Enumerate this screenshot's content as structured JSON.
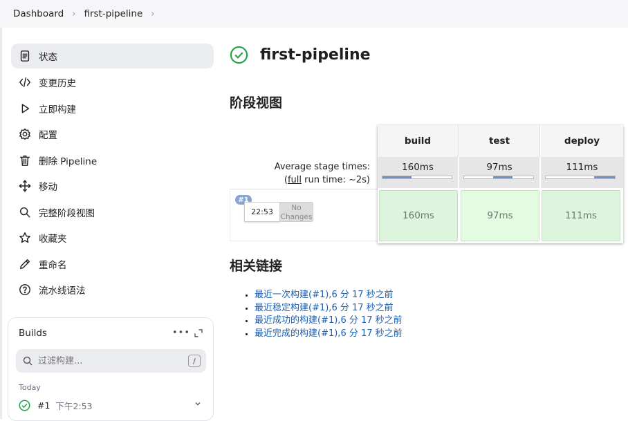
{
  "breadcrumb": {
    "items": [
      "Dashboard",
      "first-pipeline"
    ]
  },
  "sidebar": {
    "items": [
      {
        "label": "状态",
        "icon": "document-icon",
        "active": true
      },
      {
        "label": "变更历史",
        "icon": "code-icon"
      },
      {
        "label": "立即构建",
        "icon": "play-icon"
      },
      {
        "label": "配置",
        "icon": "gear-icon"
      },
      {
        "label": "删除 Pipeline",
        "icon": "trash-icon"
      },
      {
        "label": "移动",
        "icon": "move-icon"
      },
      {
        "label": "完整阶段视图",
        "icon": "search-icon"
      },
      {
        "label": "收藏夹",
        "icon": "star-icon"
      },
      {
        "label": "重命名",
        "icon": "pencil-icon"
      },
      {
        "label": "流水线语法",
        "icon": "help-icon"
      }
    ]
  },
  "builds_panel": {
    "title": "Builds",
    "filter_placeholder": "过滤构建...",
    "shortcut": "/",
    "group": "Today",
    "build": {
      "number": "#1",
      "time": "下午2:53",
      "status": "success"
    }
  },
  "page": {
    "title": "first-pipeline",
    "status_color": "#1ea446"
  },
  "stage_view": {
    "heading": "阶段视图",
    "avg_label": "Average stage times:",
    "full_run_prefix": "(",
    "full_run_link": "full",
    "full_run_suffix": " run time: ~2s)",
    "stages": [
      {
        "name": "build",
        "avg": "160ms",
        "progress_start": 0.0,
        "progress_end": 0.42
      },
      {
        "name": "test",
        "avg": "97ms",
        "progress_start": 0.42,
        "progress_end": 0.7
      },
      {
        "name": "deploy",
        "avg": "111ms",
        "progress_start": 0.7,
        "progress_end": 1.0
      }
    ],
    "run": {
      "badge": "#1",
      "time": "22:53",
      "changes_line1": "No",
      "changes_line2": "Changes",
      "cells": [
        "160ms",
        "97ms",
        "111ms"
      ]
    }
  },
  "related_links": {
    "heading": "相关链接",
    "items": [
      "最近一次构建(#1),6 分 17 秒之前",
      "最近稳定构建(#1),6 分 17 秒之前",
      "最近成功的构建(#1),6 分 17 秒之前",
      "最近完成的构建(#1),6 分 17 秒之前"
    ]
  }
}
